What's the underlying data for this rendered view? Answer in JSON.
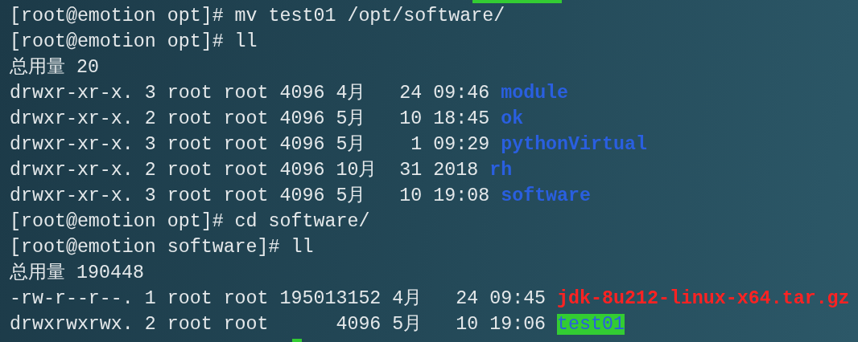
{
  "terminal": {
    "lines": [
      {
        "kind": "text",
        "text": "[root@emotion opt]# mv test01 /opt/software/"
      },
      {
        "kind": "text",
        "text": "[root@emotion opt]# ll"
      },
      {
        "kind": "text",
        "text": "总用量 20"
      },
      {
        "kind": "dir",
        "info": "drwxr-xr-x. 3 root root 4096 4月   24 09:46",
        "name": "module"
      },
      {
        "kind": "dir",
        "info": "drwxr-xr-x. 2 root root 4096 5月   10 18:45",
        "name": "ok"
      },
      {
        "kind": "dir",
        "info": "drwxr-xr-x. 3 root root 4096 5月    1 09:29",
        "name": "pythonVirtual"
      },
      {
        "kind": "dir",
        "info": "drwxr-xr-x. 2 root root 4096 10月  31 2018",
        "name": "rh"
      },
      {
        "kind": "dir",
        "info": "drwxr-xr-x. 3 root root 4096 5月   10 19:08",
        "name": "software"
      },
      {
        "kind": "text",
        "text": "[root@emotion opt]# cd software/"
      },
      {
        "kind": "text",
        "text": "[root@emotion software]# ll"
      },
      {
        "kind": "text",
        "text": "总用量 190448"
      },
      {
        "kind": "archive",
        "info": "-rw-r--r--. 1 root root 195013152 4月   24 09:45",
        "name": "jdk-8u212-linux-x64.tar.gz"
      },
      {
        "kind": "writable",
        "info": "drwxrwxrwx. 2 root root      4096 5月   10 19:06",
        "name": "test01"
      }
    ]
  }
}
